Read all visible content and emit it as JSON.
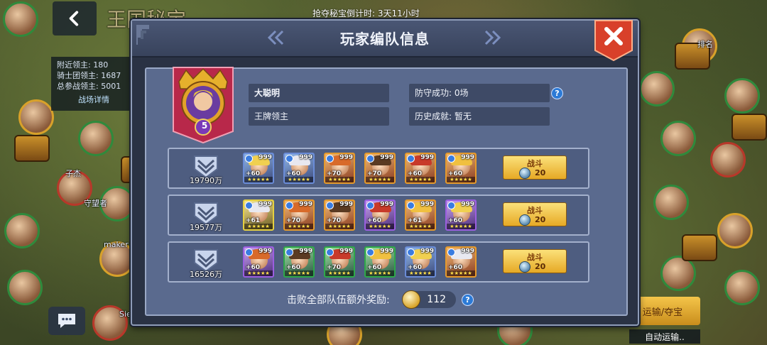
{
  "background": {
    "timer_text": "抢夺秘宝倒计时: 3天11小时",
    "info": {
      "line1": "附近领主: 180",
      "line2": "骑士团领主: 1687",
      "line3": "总参战领主: 5001",
      "link": "战场详情"
    },
    "map_labels": [
      "maker",
      "守望者",
      "子杰",
      "Siege",
      "排名",
      "王国秘宝"
    ],
    "escort_label": "运输/夺宝",
    "auto_escort_label": "自动运输.."
  },
  "dialog": {
    "title": "玩家编队信息",
    "profile": {
      "level": "5",
      "name": "大聪明",
      "title": "王牌领主",
      "defense": "防守成功: 0场",
      "history": "历史成就: 暂无"
    },
    "teams": [
      {
        "power": "19790万",
        "fight_label": "战斗",
        "cost": "20",
        "heroes": [
          {
            "level": "999",
            "plus": "+60",
            "color": "blue"
          },
          {
            "level": "999",
            "plus": "+60",
            "color": "blue"
          },
          {
            "level": "999",
            "plus": "+70",
            "color": "orange"
          },
          {
            "level": "999",
            "plus": "+70",
            "color": "orange"
          },
          {
            "level": "999",
            "plus": "+60",
            "color": "orange"
          },
          {
            "level": "999",
            "plus": "+60",
            "color": "orange"
          }
        ]
      },
      {
        "power": "19577万",
        "fight_label": "战斗",
        "cost": "20",
        "heroes": [
          {
            "level": "999",
            "plus": "+61",
            "color": "yellow"
          },
          {
            "level": "999",
            "plus": "+70",
            "color": "orange"
          },
          {
            "level": "999",
            "plus": "+70",
            "color": "orange"
          },
          {
            "level": "999",
            "plus": "+60",
            "color": "purple"
          },
          {
            "level": "999",
            "plus": "+61",
            "color": "orange"
          },
          {
            "level": "999",
            "plus": "+60",
            "color": "purple"
          }
        ]
      },
      {
        "power": "16526万",
        "fight_label": "战斗",
        "cost": "20",
        "heroes": [
          {
            "level": "999",
            "plus": "+60",
            "color": "purple"
          },
          {
            "level": "999",
            "plus": "+60",
            "color": "green"
          },
          {
            "level": "999",
            "plus": "+70",
            "color": "green"
          },
          {
            "level": "999",
            "plus": "+60",
            "color": "green"
          },
          {
            "level": "999",
            "plus": "+60",
            "color": "blue"
          },
          {
            "level": "999",
            "plus": "+60",
            "color": "orange"
          }
        ]
      }
    ],
    "reward_label": "击败全部队伍额外奖励:",
    "reward_value": "112"
  },
  "colors": {
    "accent": "#2c7ad6",
    "close": "#e04a2a",
    "fight": "#f2c040",
    "panel": "#5a6a8e"
  }
}
